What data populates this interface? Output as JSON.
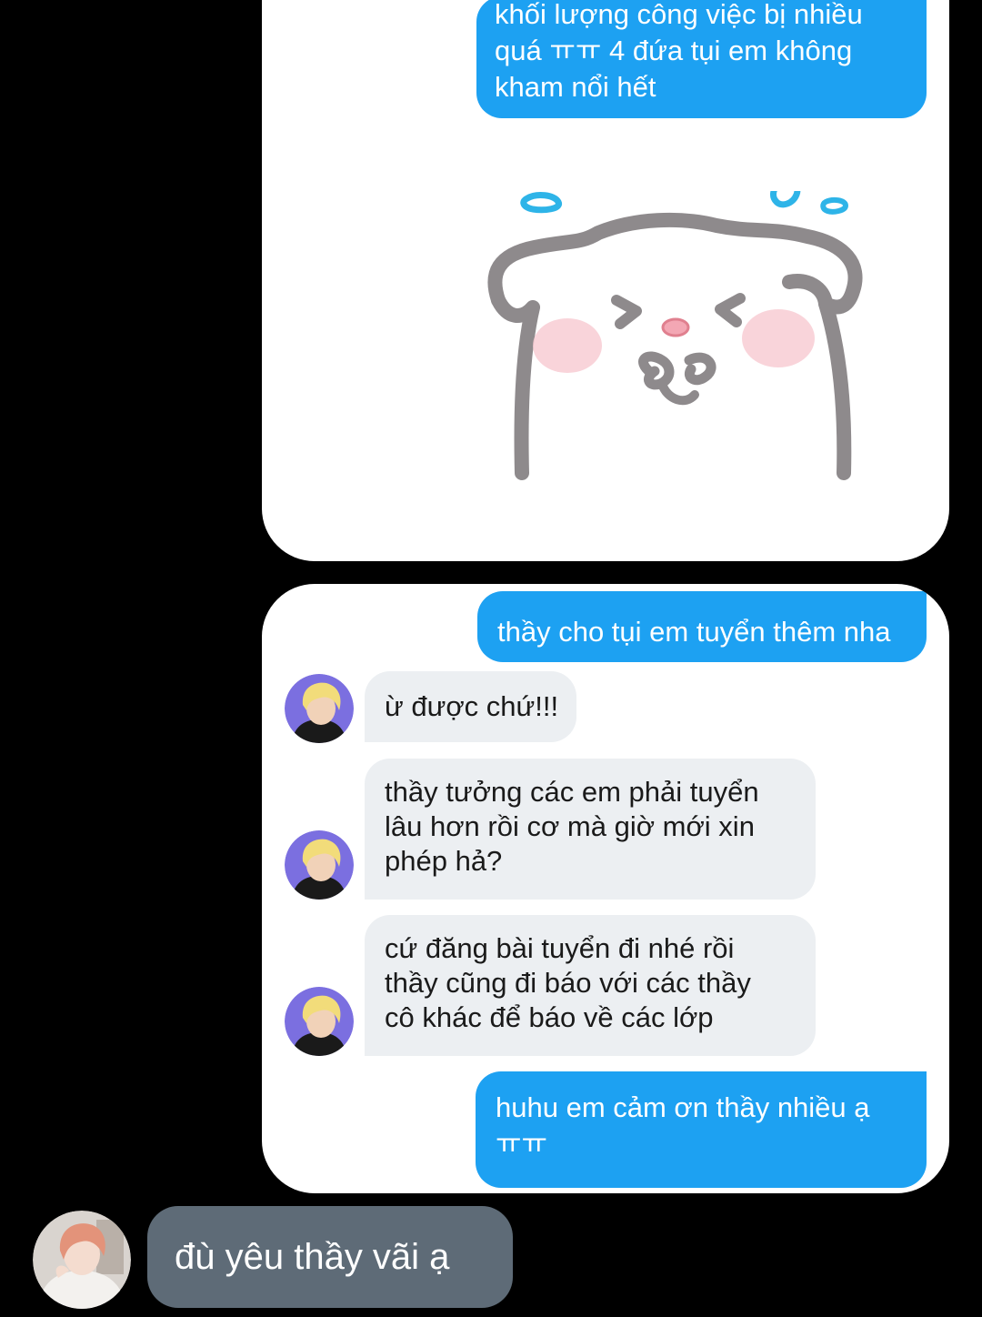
{
  "card_top": {
    "outgoing_message": "khối lượng công việc bị nhiều\nquá ㅠㅠ 4 đứa tụi em không\nkham nổi hết",
    "sticker_icon": "crying-bear-sticker"
  },
  "card_bottom": {
    "messages": [
      {
        "direction": "out",
        "text": "thầy cho tụi em tuyển thêm nha"
      },
      {
        "direction": "in",
        "text": "ừ được chứ!!!"
      },
      {
        "direction": "in",
        "text": "thầy tưởng các em phải tuyển\nlâu hơn rồi cơ mà giờ mới xin\nphép hả?"
      },
      {
        "direction": "in",
        "text": "cứ đăng bài tuyển đi nhé rồi\nthầy cũng đi báo với các thầy\ncô khác để báo về các lớp"
      },
      {
        "direction": "out",
        "text": "huhu em cảm ơn thầy nhiều ạ\nㅠㅠ"
      }
    ],
    "contact_avatar_icon": "blonde-person-avatar"
  },
  "reply": {
    "text": "đù yêu thầy vãi ạ",
    "avatar_icon": "user-avatar"
  },
  "colors": {
    "background": "#000000",
    "outgoing_bubble": "#1da1f2",
    "incoming_bubble": "#eceff2",
    "reply_bubble": "#5e6b77",
    "avatar_ring": "#7b6fe0"
  }
}
